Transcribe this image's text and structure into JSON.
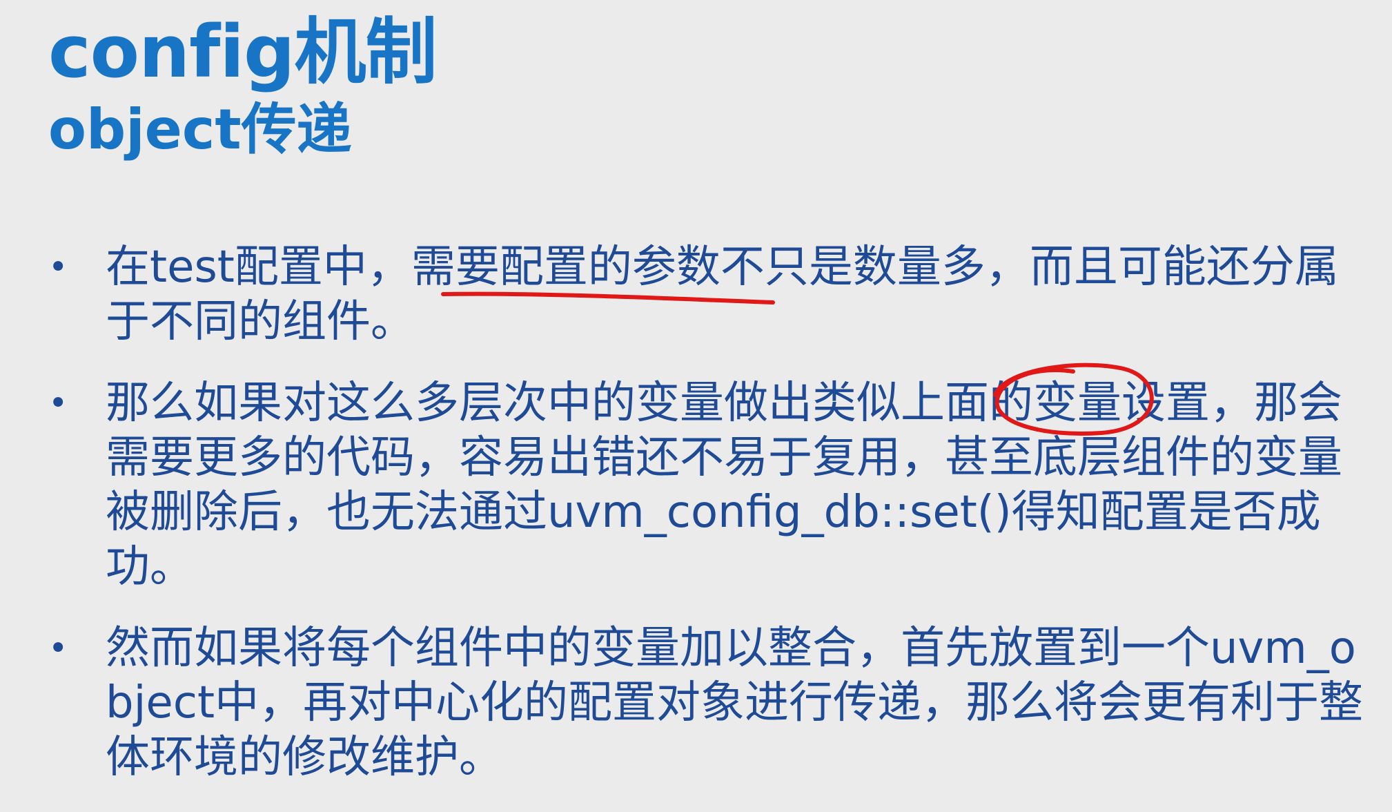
{
  "slide": {
    "title": "config机制",
    "subtitle": "object传递",
    "bullets": [
      {
        "marker": "•",
        "text": "在test配置中，需要配置的参数不只是数量多，而且可能还分属于不同的组件。"
      },
      {
        "marker": "•",
        "text": "那么如果对这么多层次中的变量做出类似上面的变量设置，那会需要更多的代码，容易出错还不易于复用，甚至底层组件的变量被删除后，也无法通过uvm_config_db::set()得知配置是否成功。"
      },
      {
        "marker": "•",
        "text": "然而如果将每个组件中的变量加以整合，首先放置到一个uvm_object中，再对中心化的配置对象进行传递，那么将会更有利于整体环境的修改维护。"
      }
    ]
  },
  "annotations": {
    "stroke_color": "#e01818"
  }
}
